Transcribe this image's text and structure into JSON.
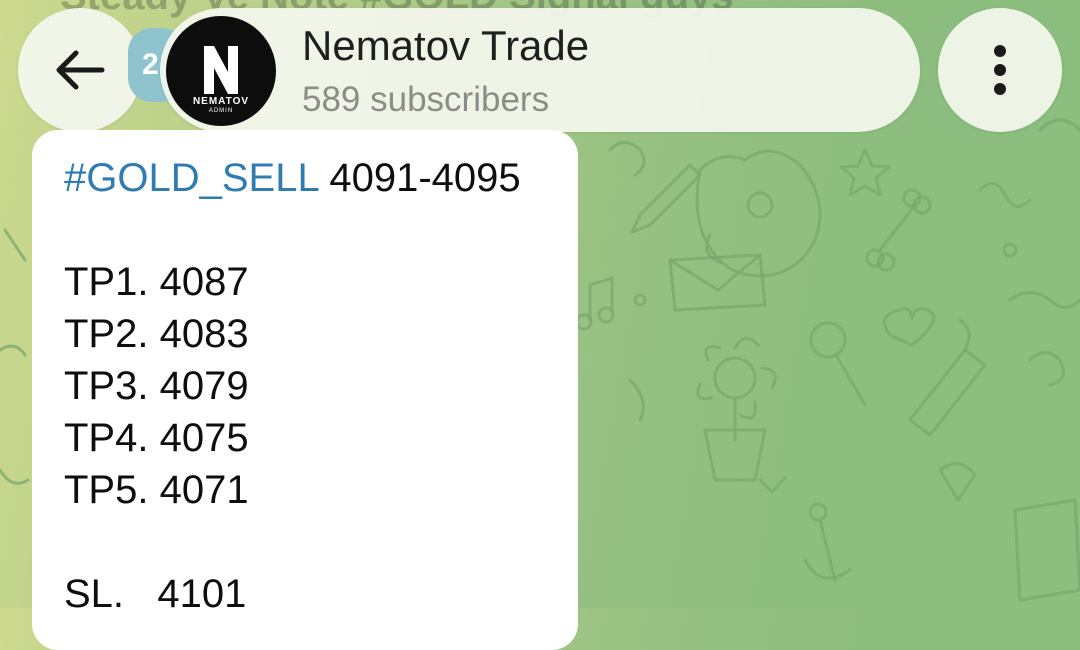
{
  "previous_message": {
    "text": "Steady Ve Note #GOLD Signal guys"
  },
  "header": {
    "back_icon": "arrow-left-icon",
    "badge_text": "2",
    "avatar": {
      "brand": "NEMATOV",
      "sub": "ADMIN",
      "initial": "N"
    },
    "title": "Nematov Trade",
    "subtitle": "589 subscribers",
    "menu_icon": "more-vertical-icon"
  },
  "message": {
    "hashtag": "#GOLD_SELL",
    "range": " 4091-4095",
    "targets": [
      "TP1. 4087",
      "TP2. 4083",
      "TP3. 4079",
      "TP4. 4075",
      "TP5. 4071"
    ],
    "stop_loss": "SL.   4101"
  },
  "colors": {
    "hashtag": "#2f7cb2",
    "bubble": "#ffffff",
    "background_left": "#cdd98f",
    "background_right": "#8dbe80"
  }
}
